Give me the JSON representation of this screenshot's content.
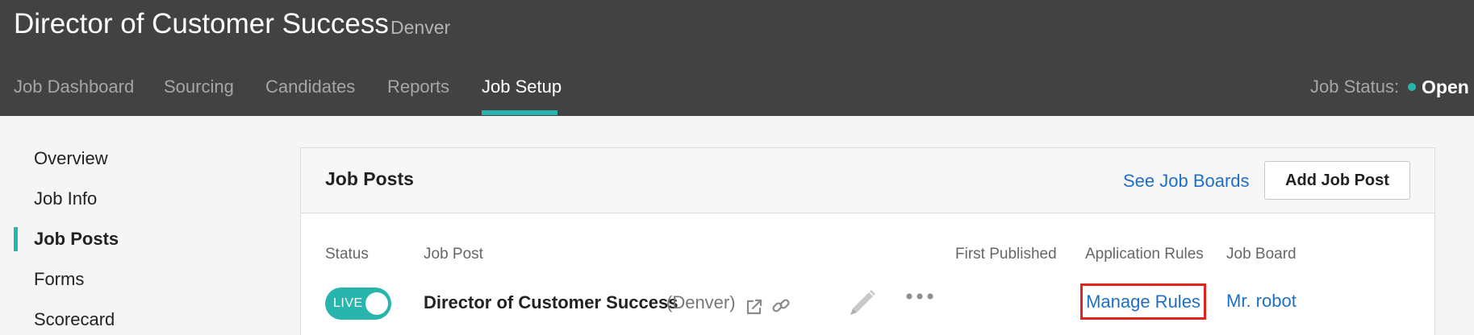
{
  "header": {
    "title": "Director of Customer Success",
    "location": "Denver"
  },
  "nav": {
    "tabs": [
      {
        "label": "Job Dashboard"
      },
      {
        "label": "Sourcing"
      },
      {
        "label": "Candidates"
      },
      {
        "label": "Reports"
      },
      {
        "label": "Job Setup",
        "active": true
      }
    ],
    "job_status_label": "Job Status:",
    "job_status_value": "Open"
  },
  "sidebar": {
    "items": [
      {
        "label": "Overview"
      },
      {
        "label": "Job Info"
      },
      {
        "label": "Job Posts",
        "active": true
      },
      {
        "label": "Forms"
      },
      {
        "label": "Scorecard"
      }
    ]
  },
  "panel": {
    "title": "Job Posts",
    "see_boards_label": "See Job Boards",
    "add_post_label": "Add Job Post",
    "columns": [
      "Status",
      "Job Post",
      "First Published",
      "Application Rules",
      "Job Board"
    ],
    "row": {
      "status": "LIVE",
      "job_post": "Director of Customer Success",
      "location": "(Denver)",
      "first_published": "",
      "application_rules": "Manage Rules",
      "job_board": "Mr. robot"
    }
  },
  "colors": {
    "header_bg": "#424242",
    "accent": "#28b5ad",
    "link": "#1f6fc5",
    "highlight_box": "#e0251f"
  },
  "icons": {
    "open_external": "external-link-icon",
    "copy_link": "link-icon",
    "edit": "pencil-icon",
    "more": "more-options-icon"
  }
}
